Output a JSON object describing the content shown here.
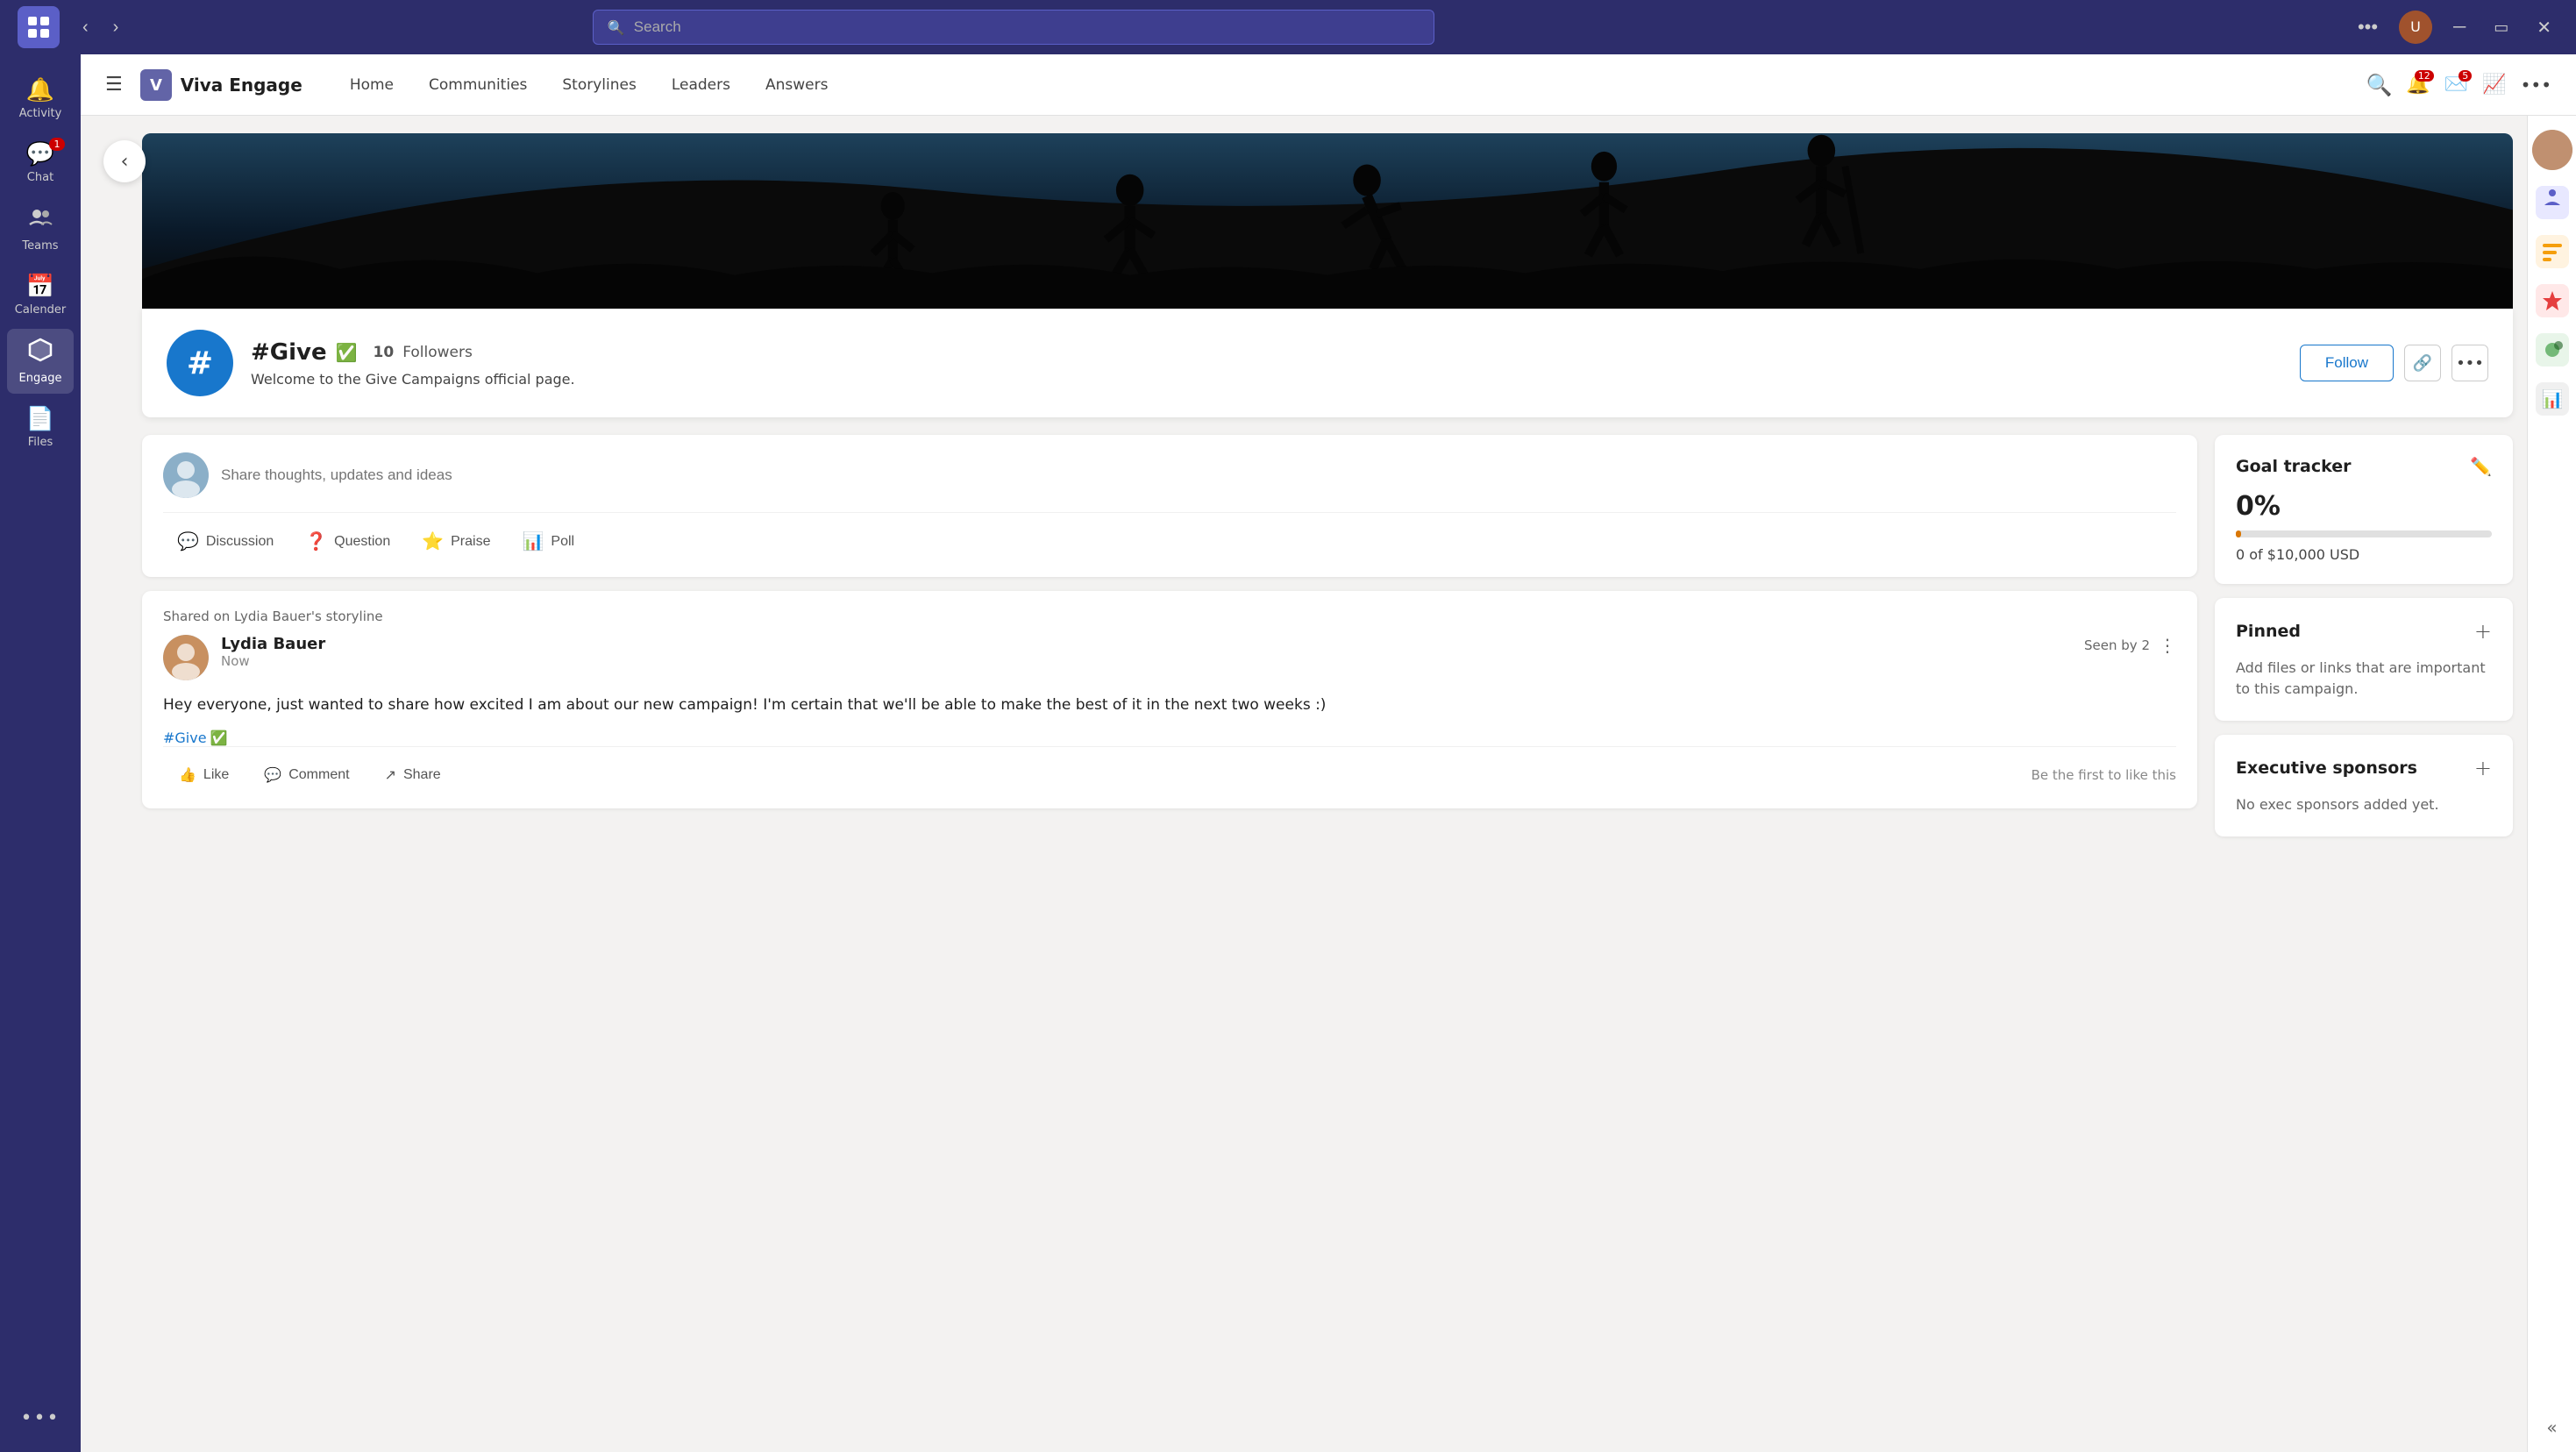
{
  "titlebar": {
    "logo_icon": "⊞",
    "search_placeholder": "Search",
    "more_label": "•••",
    "user_initial": "U"
  },
  "sidebar": {
    "items": [
      {
        "id": "activity",
        "label": "Activity",
        "icon": "🔔",
        "badge": null
      },
      {
        "id": "chat",
        "label": "Chat",
        "icon": "💬",
        "badge": "1"
      },
      {
        "id": "teams",
        "label": "Teams",
        "icon": "👥",
        "badge": null
      },
      {
        "id": "calendar",
        "label": "Calender",
        "icon": "📅",
        "badge": null
      },
      {
        "id": "engage",
        "label": "Engage",
        "icon": "◈",
        "badge": null,
        "active": true
      },
      {
        "id": "files",
        "label": "Files",
        "icon": "📄",
        "badge": null
      }
    ],
    "more_label": "•••"
  },
  "topnav": {
    "brand_name": "Viva Engage",
    "links": [
      {
        "id": "home",
        "label": "Home"
      },
      {
        "id": "communities",
        "label": "Communities"
      },
      {
        "id": "storylines",
        "label": "Storylines"
      },
      {
        "id": "leaders",
        "label": "Leaders"
      },
      {
        "id": "answers",
        "label": "Answers"
      }
    ],
    "search_icon": "🔍",
    "bell_badge": "12",
    "mail_badge": "5",
    "chart_icon": "📊",
    "more_icon": "•••"
  },
  "community": {
    "banner_alt": "People silhouettes against sky",
    "icon_text": "#",
    "name": "#Give",
    "verified": true,
    "followers_count": "10",
    "followers_label": "Followers",
    "description": "Welcome to the Give Campaigns official page.",
    "follow_label": "Follow",
    "link_icon": "🔗",
    "more_icon": "•••"
  },
  "composer": {
    "placeholder": "Share thoughts, updates and ideas",
    "actions": [
      {
        "id": "discussion",
        "label": "Discussion",
        "icon": "💬"
      },
      {
        "id": "question",
        "label": "Question",
        "icon": "❓"
      },
      {
        "id": "praise",
        "label": "Praise",
        "icon": "⭐"
      },
      {
        "id": "poll",
        "label": "Poll",
        "icon": "📊"
      }
    ]
  },
  "post": {
    "shared_label": "Shared on Lydia Bauer's storyline",
    "author": "Lydia Bauer",
    "time": "Now",
    "seen_by": "Seen by 2",
    "body": "Hey everyone, just wanted to share how excited I am about our new campaign! I'm certain that we'll be able to make the best of it in the next two weeks :)",
    "tag": "#Give",
    "tag_verified": true,
    "like_label": "Like",
    "comment_label": "Comment",
    "share_label": "Share",
    "first_like": "Be the first to like this"
  },
  "goal_tracker": {
    "title": "Goal tracker",
    "percent": "0%",
    "bar_fill_percent": 2,
    "amount_current": "0",
    "amount_target": "$10,000 USD",
    "amount_text": "0 of $10,000 USD"
  },
  "pinned": {
    "title": "Pinned",
    "add_icon": "+",
    "description": "Add files or links that are important to this campaign."
  },
  "executive_sponsors": {
    "title": "Executive sponsors",
    "add_icon": "+",
    "description": "No exec sponsors added yet."
  },
  "far_right": {
    "collapse_icon": "«"
  }
}
